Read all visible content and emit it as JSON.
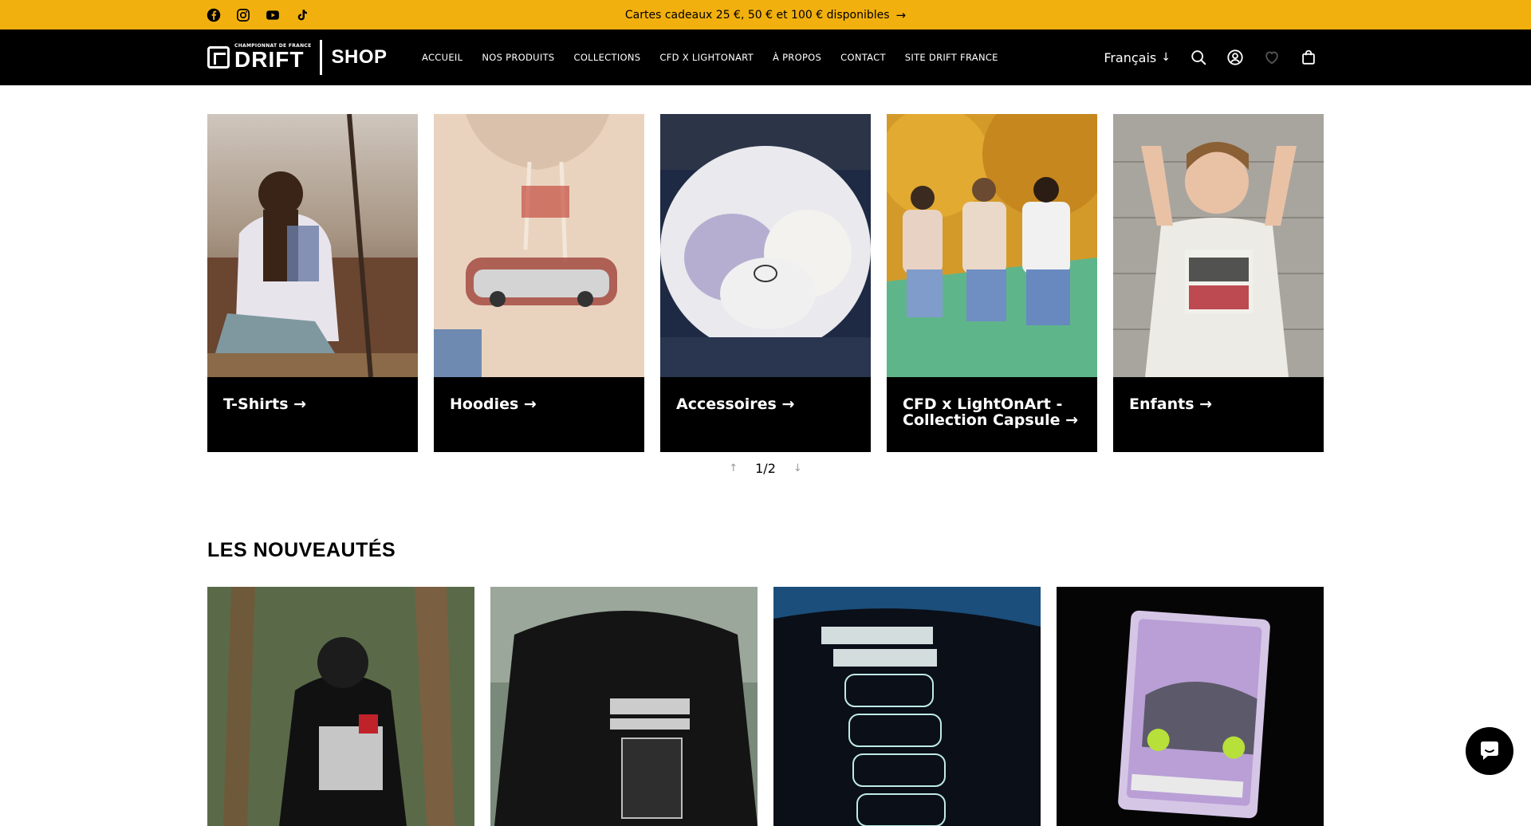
{
  "announcement": {
    "text": "Cartes cadeaux 25 €, 50 € et 100 € disponibles",
    "arrow": "→",
    "social_icons": [
      "facebook-icon",
      "instagram-icon",
      "youtube-icon",
      "tiktok-icon"
    ],
    "background": "#f2b00f"
  },
  "header": {
    "logo_small": "CHAMPIONNAT DE FRANCE",
    "logo_main": "DRIFT",
    "logo_shop": "SHOP",
    "nav": [
      "ACCUEIL",
      "NOS PRODUITS",
      "COLLECTIONS",
      "CFD X LIGHTONART",
      "À PROPOS",
      "CONTACT",
      "SITE DRIFT FRANCE"
    ],
    "language": "Français",
    "language_arrow": "↓",
    "icons": [
      "search-icon",
      "account-icon",
      "wishlist-icon",
      "cart-icon"
    ]
  },
  "collections": [
    {
      "label": "T-Shirts →"
    },
    {
      "label": "Hoodies →"
    },
    {
      "label": "Accessoires →"
    },
    {
      "label": "CFD x LightOnArt - Collection Capsule →"
    },
    {
      "label": "Enfants →"
    }
  ],
  "pager": {
    "prev": "↑",
    "text": "1/2",
    "next": "↓"
  },
  "new_section": {
    "title": "LES NOUVEAUTÉS"
  },
  "products_count_visible": 4,
  "chat": {
    "icon": "chat-icon"
  }
}
